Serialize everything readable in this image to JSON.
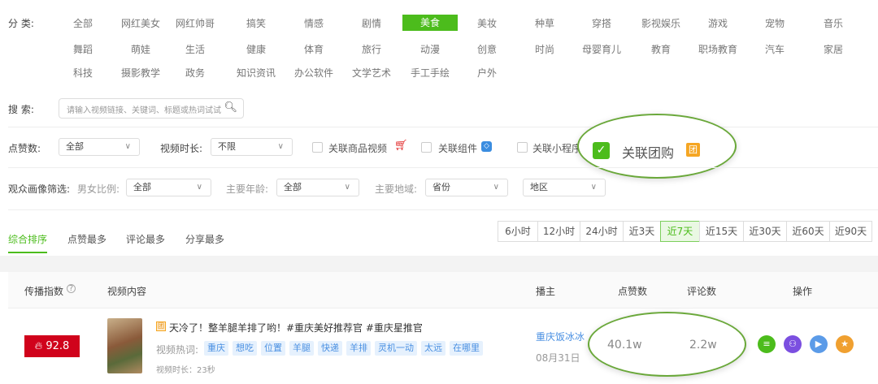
{
  "category": {
    "label": "分  类:",
    "rows": [
      [
        "全部",
        "网红美女",
        "网红帅哥",
        "搞笑",
        "情感",
        "剧情",
        "美食",
        "美妆",
        "种草",
        "穿搭",
        "影视娱乐",
        "游戏",
        "宠物",
        "音乐"
      ],
      [
        "舞蹈",
        "萌娃",
        "生活",
        "健康",
        "体育",
        "旅行",
        "动漫",
        "创意",
        "时尚",
        "母婴育儿",
        "教育",
        "职场教育",
        "汽车",
        "家居"
      ],
      [
        "科技",
        "摄影教学",
        "政务",
        "知识资讯",
        "办公软件",
        "文学艺术",
        "手工手绘",
        "户外"
      ]
    ],
    "selected": "美食"
  },
  "search": {
    "label": "搜 索:",
    "placeholder": "请输入视频链接、关键词、标题或热词试试"
  },
  "filters": {
    "likes_label": "点赞数:",
    "likes_value": "全部",
    "duration_label": "视频时长:",
    "duration_value": "不限",
    "checkboxes": [
      {
        "label": "关联商品视频",
        "checked": false
      },
      {
        "label": "关联组件",
        "checked": false
      },
      {
        "label": "关联小程序",
        "checked": false
      },
      {
        "label": "关联团购",
        "checked": true
      }
    ],
    "group_badge": "团"
  },
  "audience": {
    "label": "观众画像筛选:",
    "gender_label": "男女比例:",
    "gender_value": "全部",
    "age_label": "主要年龄:",
    "age_value": "全部",
    "region_label": "主要地域:",
    "province_value": "省份",
    "district_value": "地区"
  },
  "sort_tabs": [
    "综合排序",
    "点赞最多",
    "评论最多",
    "分享最多"
  ],
  "time_ranges": [
    "6小时",
    "12小时",
    "24小时",
    "近3天",
    "近7天",
    "近15天",
    "近30天",
    "近60天",
    "近90天"
  ],
  "selected_time": "近7天",
  "table": {
    "headers": [
      "传播指数",
      "视频内容",
      "播主",
      "点赞数",
      "评论数",
      "操作"
    ],
    "rows": [
      {
        "index": "92.8",
        "badge": "团",
        "title": "天冷了！整羊腿羊排了哟！#重庆美好推荐官 #重庆星推官",
        "hotwords_label": "视频热词:",
        "hotwords": [
          "重庆",
          "想吃",
          "位置",
          "羊腿",
          "快递",
          "羊排",
          "灵机一动",
          "太远",
          "在哪里"
        ],
        "duration": "视频时长：23秒",
        "author": "重庆饭冰冰",
        "date": "08月31日",
        "likes": "40.1w",
        "comments": "2.2w"
      }
    ]
  },
  "colors": {
    "accent": "#4cbc1c",
    "highlight_ring": "#6aa83a",
    "index_red": "#d0021b"
  }
}
